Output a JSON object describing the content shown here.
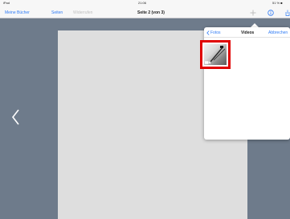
{
  "status_bar": {
    "carrier": "iPad",
    "time": "21:06",
    "battery": "51 % ■"
  },
  "nav_bar": {
    "my_books": "Meine Bücher",
    "pages": "Seiten",
    "undo": "Widerrufen",
    "page_title": "Seite 2 (von 3)"
  },
  "popover": {
    "back_label": "Fotos",
    "title": "Videos",
    "cancel_label": "Abbrechen"
  },
  "colors": {
    "accent": "#2f7bf5",
    "highlight": "#e00000"
  }
}
